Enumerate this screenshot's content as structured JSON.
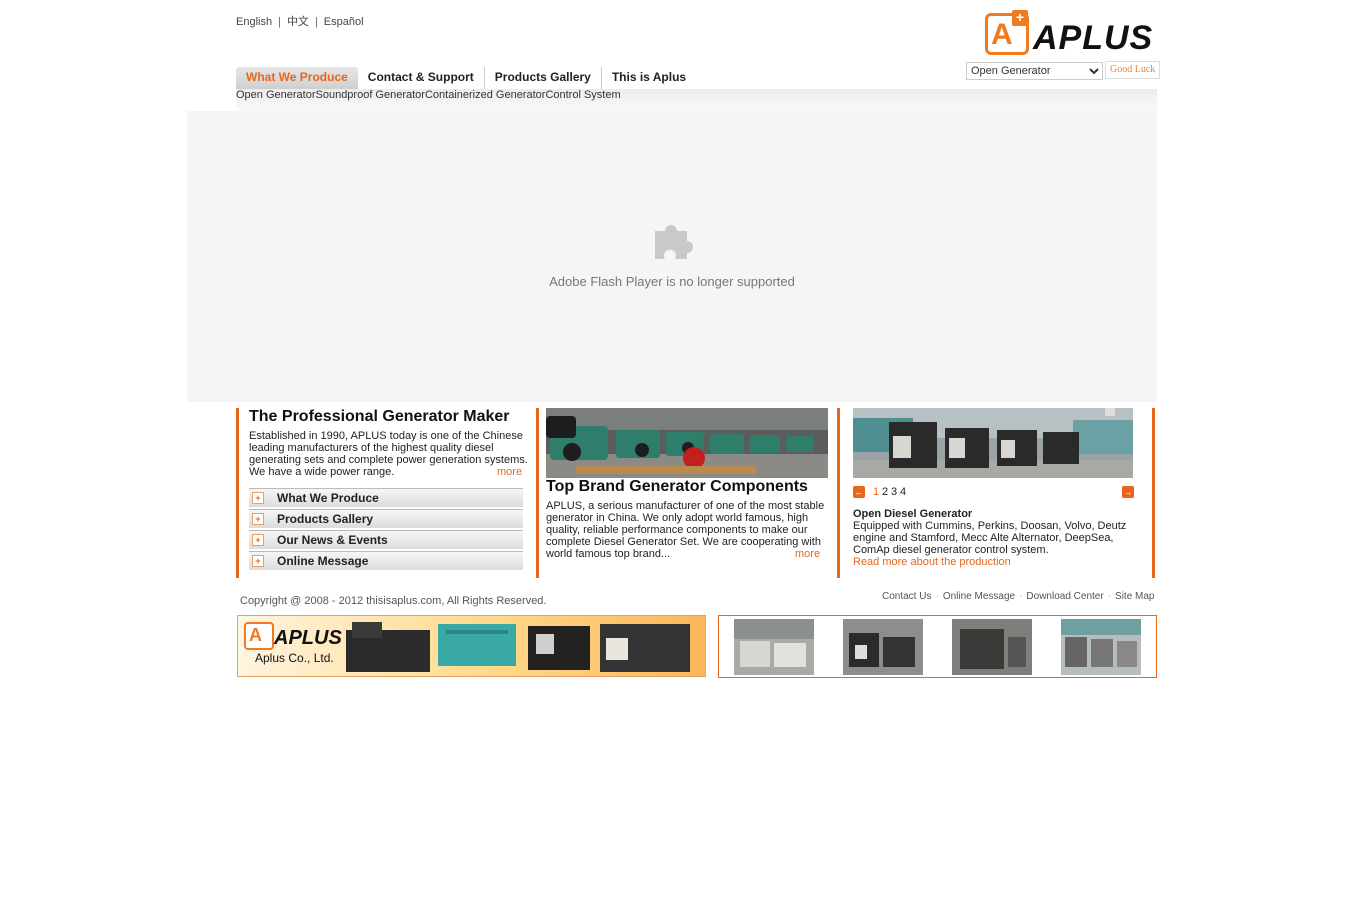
{
  "lang": {
    "english": "English",
    "chinese": "中文",
    "spanish": "Español",
    "sep": "|"
  },
  "logo": {
    "text": "APLUS",
    "mark": "A",
    "plus": "+"
  },
  "search": {
    "selected": "Open Generator",
    "button": "Good Luck"
  },
  "nav": {
    "items": [
      "What We Produce",
      "Contact & Support",
      "Products Gallery",
      "This is Aplus"
    ],
    "sub": [
      "Open Generator",
      "Soundproof Generator",
      "Containerized Generator",
      "Control System"
    ]
  },
  "flash": {
    "message": "Adobe Flash Player is no longer supported",
    "icon": "puzzle-icon"
  },
  "col1": {
    "title": "The Professional Generator Maker",
    "body": "Established in 1990, APLUS today is one of the Chinese leading manufacturers of the highest quality diesel generating sets and complete power generation systems. We have a wide power range.",
    "more": "more",
    "links": [
      "What We Produce",
      "Products Gallery",
      "Our News & Events",
      "Online Message"
    ],
    "plus": "+"
  },
  "col2": {
    "title": "Top Brand Generator Components",
    "body": "APLUS, a serious manufacturer of one of the most stable generator in China. We only adopt world famous, high quality, reliable performance components to make our complete Diesel Generator Set. We are cooperating with world famous top brand...",
    "more": "more"
  },
  "col3": {
    "pages": [
      "1",
      "2",
      "3",
      "4"
    ],
    "title": "Open Diesel Generator",
    "body": "Equipped with Cummins, Perkins, Doosan, Volvo, Deutz engine and Stamford, Mecc Alte Alternator, DeepSea, ComAp diesel generator control system.",
    "link": "Read more about the production",
    "prev": "←",
    "next": "→"
  },
  "footer": {
    "copyright": "Copyright @ 2008 - 2012 thisisaplus.com, All Rights Reserved.",
    "links": [
      "Contact Us",
      "Online Message",
      "Download Center",
      "Site Map"
    ],
    "sep": "·"
  },
  "banner": {
    "logo_text": "APLUS",
    "company": "Aplus Co., Ltd."
  },
  "colors": {
    "accent": "#e8661c",
    "logo": "#f07a1e"
  }
}
